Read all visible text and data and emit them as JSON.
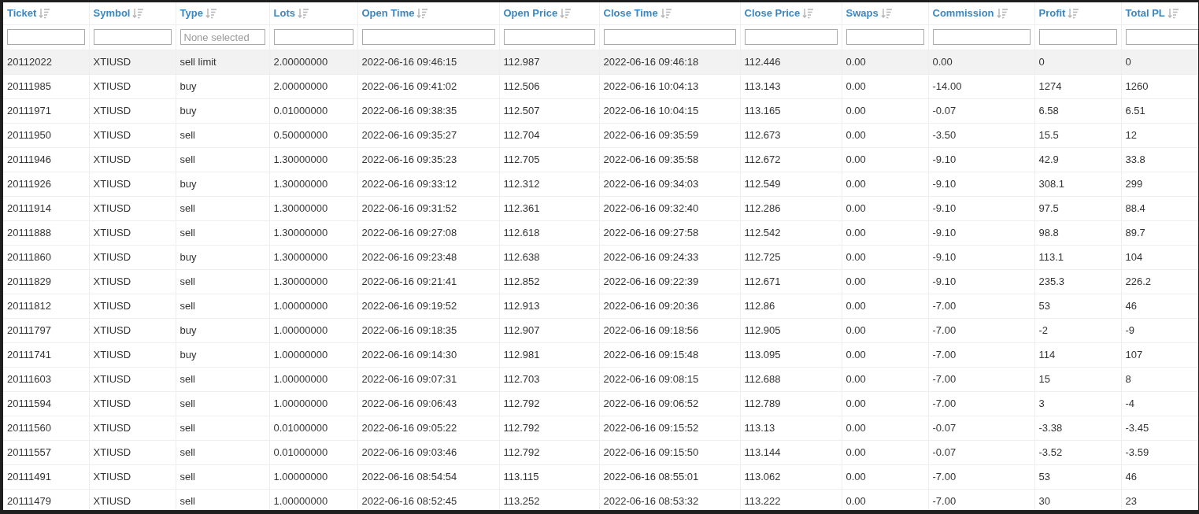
{
  "table": {
    "columns": [
      {
        "label": "Ticket"
      },
      {
        "label": "Symbol"
      },
      {
        "label": "Type",
        "placeholder": "None selected"
      },
      {
        "label": "Lots"
      },
      {
        "label": "Open Time"
      },
      {
        "label": "Open Price"
      },
      {
        "label": "Close Time"
      },
      {
        "label": "Close Price"
      },
      {
        "label": "Swaps"
      },
      {
        "label": "Commission"
      },
      {
        "label": "Profit"
      },
      {
        "label": "Total PL"
      }
    ],
    "rows": [
      {
        "highlighted": true,
        "cells": [
          "20112022",
          "XTIUSD",
          "sell limit",
          "2.00000000",
          "2022-06-16 09:46:15",
          "112.987",
          "2022-06-16 09:46:18",
          "112.446",
          "0.00",
          "0.00",
          "0",
          "0"
        ]
      },
      {
        "highlighted": false,
        "cells": [
          "20111985",
          "XTIUSD",
          "buy",
          "2.00000000",
          "2022-06-16 09:41:02",
          "112.506",
          "2022-06-16 10:04:13",
          "113.143",
          "0.00",
          "-14.00",
          "1274",
          "1260"
        ]
      },
      {
        "highlighted": false,
        "cells": [
          "20111971",
          "XTIUSD",
          "buy",
          "0.01000000",
          "2022-06-16 09:38:35",
          "112.507",
          "2022-06-16 10:04:15",
          "113.165",
          "0.00",
          "-0.07",
          "6.58",
          "6.51"
        ]
      },
      {
        "highlighted": false,
        "cells": [
          "20111950",
          "XTIUSD",
          "sell",
          "0.50000000",
          "2022-06-16 09:35:27",
          "112.704",
          "2022-06-16 09:35:59",
          "112.673",
          "0.00",
          "-3.50",
          "15.5",
          "12"
        ]
      },
      {
        "highlighted": false,
        "cells": [
          "20111946",
          "XTIUSD",
          "sell",
          "1.30000000",
          "2022-06-16 09:35:23",
          "112.705",
          "2022-06-16 09:35:58",
          "112.672",
          "0.00",
          "-9.10",
          "42.9",
          "33.8"
        ]
      },
      {
        "highlighted": false,
        "cells": [
          "20111926",
          "XTIUSD",
          "buy",
          "1.30000000",
          "2022-06-16 09:33:12",
          "112.312",
          "2022-06-16 09:34:03",
          "112.549",
          "0.00",
          "-9.10",
          "308.1",
          "299"
        ]
      },
      {
        "highlighted": false,
        "cells": [
          "20111914",
          "XTIUSD",
          "sell",
          "1.30000000",
          "2022-06-16 09:31:52",
          "112.361",
          "2022-06-16 09:32:40",
          "112.286",
          "0.00",
          "-9.10",
          "97.5",
          "88.4"
        ]
      },
      {
        "highlighted": false,
        "cells": [
          "20111888",
          "XTIUSD",
          "sell",
          "1.30000000",
          "2022-06-16 09:27:08",
          "112.618",
          "2022-06-16 09:27:58",
          "112.542",
          "0.00",
          "-9.10",
          "98.8",
          "89.7"
        ]
      },
      {
        "highlighted": false,
        "cells": [
          "20111860",
          "XTIUSD",
          "buy",
          "1.30000000",
          "2022-06-16 09:23:48",
          "112.638",
          "2022-06-16 09:24:33",
          "112.725",
          "0.00",
          "-9.10",
          "113.1",
          "104"
        ]
      },
      {
        "highlighted": false,
        "cells": [
          "20111829",
          "XTIUSD",
          "sell",
          "1.30000000",
          "2022-06-16 09:21:41",
          "112.852",
          "2022-06-16 09:22:39",
          "112.671",
          "0.00",
          "-9.10",
          "235.3",
          "226.2"
        ]
      },
      {
        "highlighted": false,
        "cells": [
          "20111812",
          "XTIUSD",
          "sell",
          "1.00000000",
          "2022-06-16 09:19:52",
          "112.913",
          "2022-06-16 09:20:36",
          "112.86",
          "0.00",
          "-7.00",
          "53",
          "46"
        ]
      },
      {
        "highlighted": false,
        "cells": [
          "20111797",
          "XTIUSD",
          "buy",
          "1.00000000",
          "2022-06-16 09:18:35",
          "112.907",
          "2022-06-16 09:18:56",
          "112.905",
          "0.00",
          "-7.00",
          "-2",
          "-9"
        ]
      },
      {
        "highlighted": false,
        "cells": [
          "20111741",
          "XTIUSD",
          "buy",
          "1.00000000",
          "2022-06-16 09:14:30",
          "112.981",
          "2022-06-16 09:15:48",
          "113.095",
          "0.00",
          "-7.00",
          "114",
          "107"
        ]
      },
      {
        "highlighted": false,
        "cells": [
          "20111603",
          "XTIUSD",
          "sell",
          "1.00000000",
          "2022-06-16 09:07:31",
          "112.703",
          "2022-06-16 09:08:15",
          "112.688",
          "0.00",
          "-7.00",
          "15",
          "8"
        ]
      },
      {
        "highlighted": false,
        "cells": [
          "20111594",
          "XTIUSD",
          "sell",
          "1.00000000",
          "2022-06-16 09:06:43",
          "112.792",
          "2022-06-16 09:06:52",
          "112.789",
          "0.00",
          "-7.00",
          "3",
          "-4"
        ]
      },
      {
        "highlighted": false,
        "cells": [
          "20111560",
          "XTIUSD",
          "sell",
          "0.01000000",
          "2022-06-16 09:05:22",
          "112.792",
          "2022-06-16 09:15:52",
          "113.13",
          "0.00",
          "-0.07",
          "-3.38",
          "-3.45"
        ]
      },
      {
        "highlighted": false,
        "cells": [
          "20111557",
          "XTIUSD",
          "sell",
          "0.01000000",
          "2022-06-16 09:03:46",
          "112.792",
          "2022-06-16 09:15:50",
          "113.144",
          "0.00",
          "-0.07",
          "-3.52",
          "-3.59"
        ]
      },
      {
        "highlighted": false,
        "cells": [
          "20111491",
          "XTIUSD",
          "sell",
          "1.00000000",
          "2022-06-16 08:54:54",
          "113.115",
          "2022-06-16 08:55:01",
          "113.062",
          "0.00",
          "-7.00",
          "53",
          "46"
        ]
      },
      {
        "highlighted": false,
        "cells": [
          "20111479",
          "XTIUSD",
          "sell",
          "1.00000000",
          "2022-06-16 08:52:45",
          "113.252",
          "2022-06-16 08:53:32",
          "113.222",
          "0.00",
          "-7.00",
          "30",
          "23"
        ]
      }
    ]
  }
}
